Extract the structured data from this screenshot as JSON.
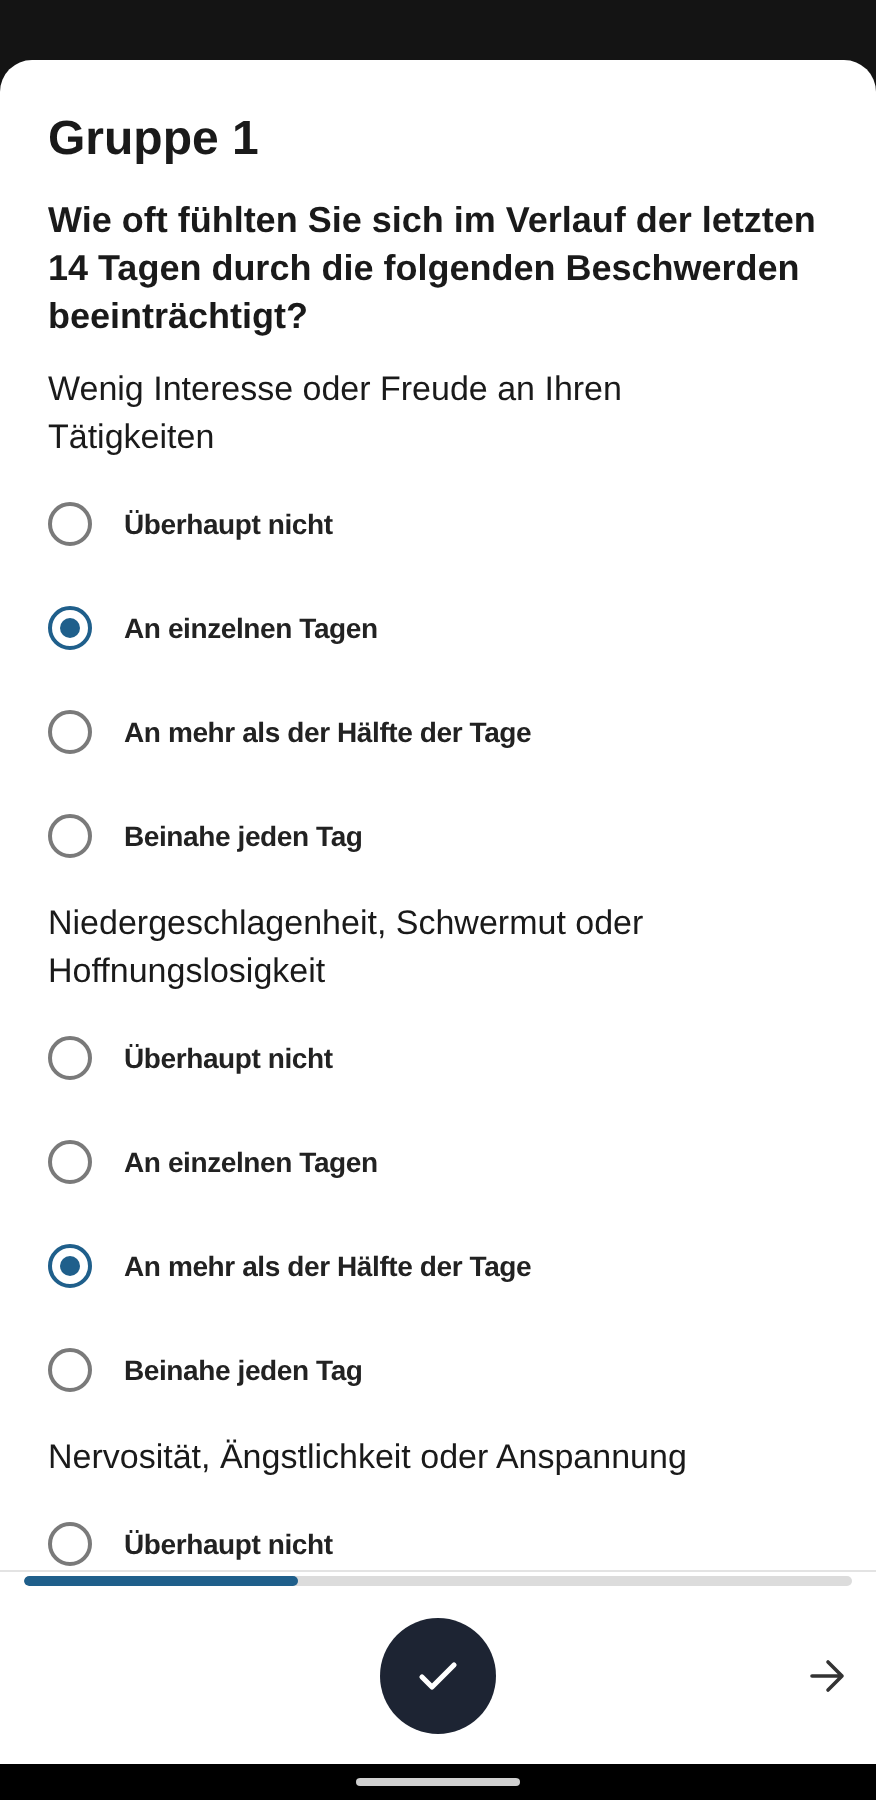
{
  "title": "Gruppe 1",
  "question": "Wie oft fühlten Sie sich im Verlauf der letzten 14 Tagen durch die folgenden Beschwerden beeinträchtigt?",
  "items": [
    {
      "label": "Wenig Interesse oder Freude an Ihren Tätigkeiten",
      "options": [
        {
          "label": "Überhaupt nicht",
          "selected": false
        },
        {
          "label": "An einzelnen Tagen",
          "selected": true
        },
        {
          "label": "An mehr als der Hälfte der Tage",
          "selected": false
        },
        {
          "label": "Beinahe jeden Tag",
          "selected": false
        }
      ]
    },
    {
      "label": "Niedergeschlagenheit, Schwermut oder Hoffnungslosigkeit",
      "options": [
        {
          "label": "Überhaupt nicht",
          "selected": false
        },
        {
          "label": "An einzelnen Tagen",
          "selected": false
        },
        {
          "label": "An mehr als der Hälfte der Tage",
          "selected": true
        },
        {
          "label": "Beinahe jeden Tag",
          "selected": false
        }
      ]
    },
    {
      "label": "Nervosität, Ängstlichkeit oder Anspannung",
      "options": [
        {
          "label": "Überhaupt nicht",
          "selected": false
        }
      ]
    }
  ],
  "progress": {
    "level": 0.33
  }
}
